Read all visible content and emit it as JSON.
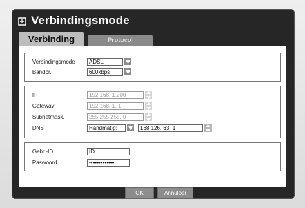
{
  "window": {
    "title": "Verbindingsmode"
  },
  "tabs": [
    {
      "label": "Verbinding"
    },
    {
      "label": "Protocol"
    }
  ],
  "connection": {
    "mode_label": "· Verbindingsmode",
    "mode_value": "ADSL",
    "bandwidth_label": "· Bandbr.",
    "bandwidth_value": "600kbps"
  },
  "network": {
    "ip_label": "· IP",
    "ip_value": "192.168.  1.200",
    "gateway_label": "· Gateway",
    "gateway_value": "192.168.  1.   1",
    "subnet_label": "· Subnetmask.",
    "subnet_value": "255.255.255.  0",
    "dns_label": "· DNS",
    "dns_mode": "Handmatig:",
    "dns_value": "168.126.  63.  1"
  },
  "login": {
    "user_label": "· Gebr.-ID",
    "user_value": "ID",
    "password_label": "· Paswoord",
    "password_value": "•••••••••••••"
  },
  "buttons": {
    "ok": "OK",
    "cancel": "Annuleer"
  }
}
